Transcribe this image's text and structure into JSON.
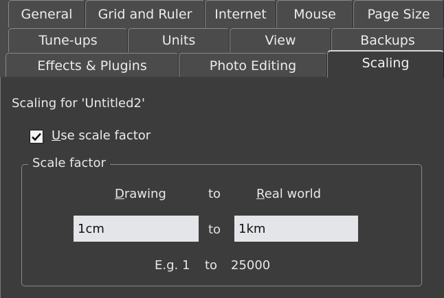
{
  "tabs": {
    "row1": [
      "General",
      "Grid and Ruler",
      "Internet",
      "Mouse",
      "Page Size"
    ],
    "row2": [
      "Tune-ups",
      "Units",
      "View",
      "Backups"
    ],
    "row3": [
      "Effects & Plugins",
      "Photo Editing",
      "Scaling"
    ],
    "active": "Scaling"
  },
  "panel": {
    "heading": "Scaling for 'Untitled2'",
    "use_scale_factor": {
      "mnemonic": "U",
      "label_rest": "se scale factor",
      "checked": true
    },
    "group": {
      "title": "Scale factor",
      "drawing_mnemonic": "D",
      "drawing_rest": "rawing",
      "to_header": "to",
      "real_world_mnemonic": "R",
      "real_world_rest": "eal world",
      "drawing_value": "1cm",
      "to_field": "to",
      "real_world_value": "1km",
      "example_prefix": "E.g. 1",
      "example_to": "to",
      "example_value": "25000"
    }
  },
  "colors": {
    "background": "#4a4a4a",
    "panel": "#3c3c3c",
    "field": "#e4e5e8"
  }
}
